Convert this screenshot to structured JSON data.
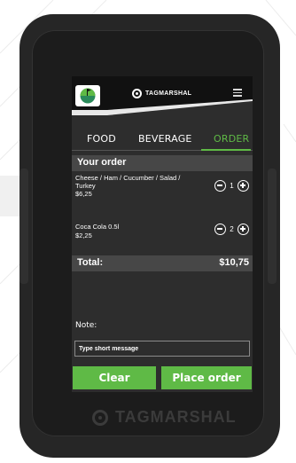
{
  "app": {
    "brand_name": "TAGMARSHAL",
    "device_brand": "TAGMARSHAL"
  },
  "tabs": [
    {
      "label": "FOOD",
      "active": false
    },
    {
      "label": "BEVERAGE",
      "active": false
    },
    {
      "label": "ORDER",
      "active": true
    }
  ],
  "order": {
    "title": "Your order",
    "items": [
      {
        "name": "Cheese / Ham / Cucumber / Salad / Turkey",
        "price": "$6,25",
        "quantity": "1"
      },
      {
        "name": "Coca Cola 0.5l",
        "price": "$2,25",
        "quantity": "2"
      }
    ],
    "total_label": "Total:",
    "total_value": "$10,75"
  },
  "note": {
    "label": "Note:",
    "placeholder": "Type short message"
  },
  "buttons": {
    "clear": "Clear",
    "place_order": "Place order"
  },
  "colors": {
    "accent": "#5fba46",
    "screen_bg": "#2d2d2d",
    "bar_bg": "#474747",
    "device": "#262626"
  }
}
